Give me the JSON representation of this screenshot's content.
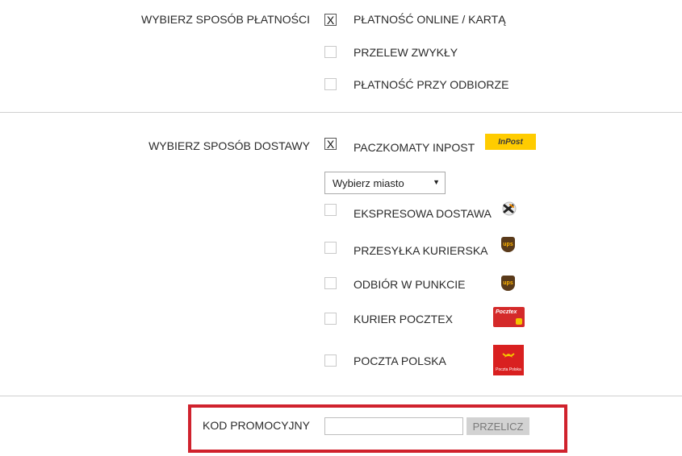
{
  "payment": {
    "section_label": "WYBIERZ SPOSÓB PŁATNOŚCI",
    "options": [
      {
        "label": "PŁATNOŚĆ ONLINE / KARTĄ",
        "checked": true
      },
      {
        "label": "PRZELEW ZWYKŁY",
        "checked": false
      },
      {
        "label": "PŁATNOŚĆ PRZY ODBIORZE",
        "checked": false
      }
    ]
  },
  "delivery": {
    "section_label": "WYBIERZ SPOSÓB DOSTAWY",
    "options": [
      {
        "label": "PACZKOMATY INPOST",
        "checked": true,
        "icon": "inpost-logo"
      },
      {
        "label": "EKSPRESOWA DOSTAWA",
        "checked": false,
        "icon": "express-delivery-icon"
      },
      {
        "label": "PRZESYŁKA KURIERSKA",
        "checked": false,
        "icon": "ups-logo"
      },
      {
        "label": "ODBIÓR W PUNKCIE",
        "checked": false,
        "icon": "ups-logo"
      },
      {
        "label": "KURIER POCZTEX",
        "checked": false,
        "icon": "pocztex-logo"
      },
      {
        "label": "POCZTA POLSKA",
        "checked": false,
        "icon": "poczta-polska-logo"
      }
    ],
    "city_select": {
      "value": "Wybierz miasto"
    },
    "logo_text": {
      "inpost": "InPost",
      "pocztex": "Pocztex",
      "poczta_polska": "Poczta Polska",
      "ups": "ups"
    }
  },
  "promo": {
    "label": "KOD PROMOCYJNY",
    "input_value": "",
    "button_label": "PRZELICZ"
  },
  "checkbox_mark": "X",
  "colors": {
    "accent_red": "#d0222d",
    "inpost_yellow": "#ffcc00",
    "ups_brown": "#5a3a1a"
  }
}
